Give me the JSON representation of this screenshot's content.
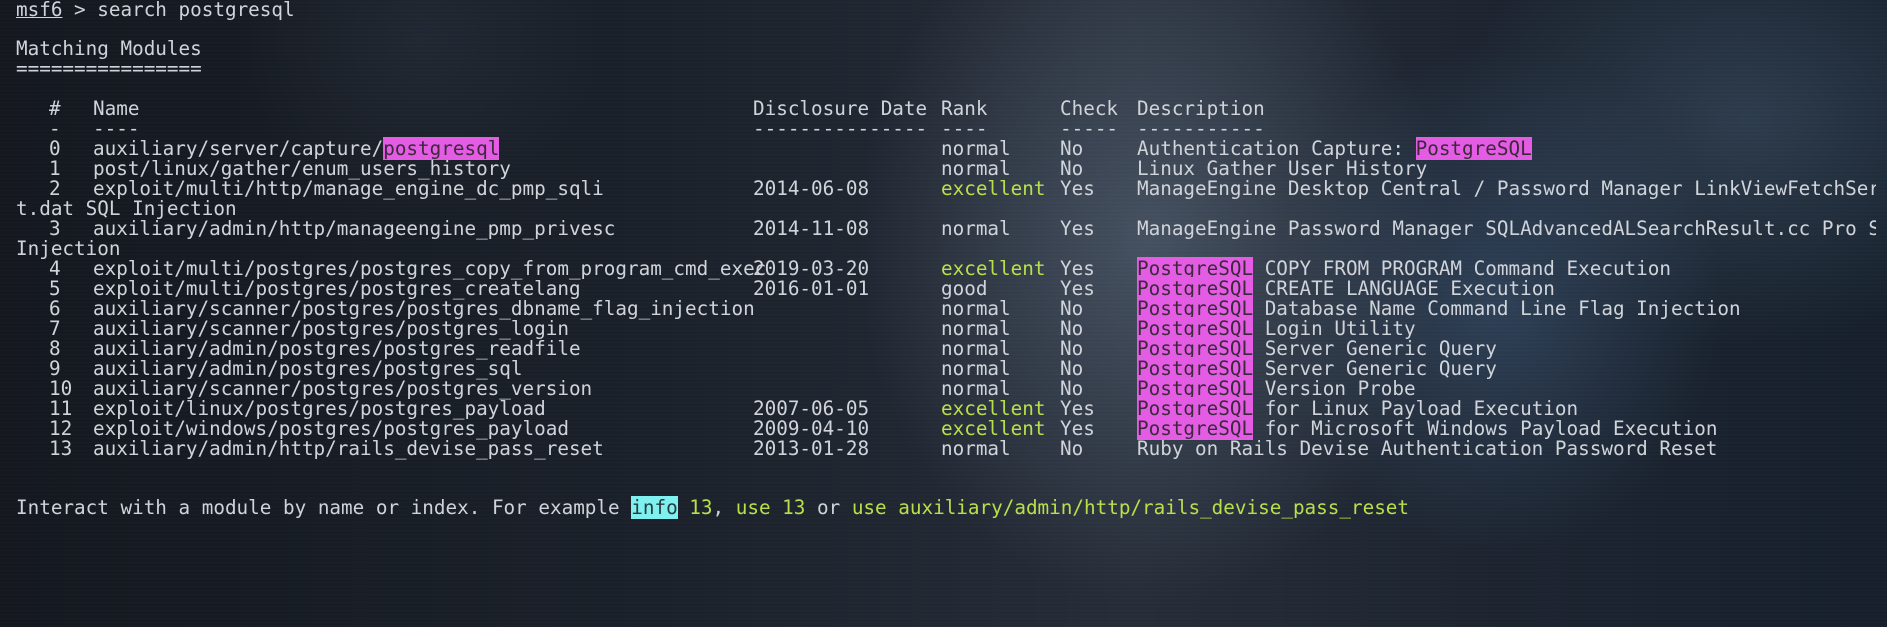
{
  "prompt": {
    "name": "msf6",
    "separator": " > ",
    "command": "search postgresql"
  },
  "section_title": "Matching Modules",
  "section_underline": "================",
  "columns": {
    "num": "#",
    "name": "Name",
    "date": "Disclosure Date",
    "rank": "Rank",
    "check": "Check",
    "desc": "Description"
  },
  "column_underlines": {
    "num": "-",
    "name": "----",
    "date": "---------------",
    "rank": "----",
    "check": "-----",
    "desc": "-----------"
  },
  "rows": [
    {
      "num": "0",
      "name_pre": "auxiliary/server/capture/",
      "name_hl": "postgresql",
      "date": "",
      "rank": "normal",
      "check": "No",
      "desc_pre": "Authentication Capture: ",
      "desc_hl": "PostgreSQL",
      "desc": ""
    },
    {
      "num": "1",
      "name_pre": "post/linux/gather/enum_users_history",
      "name_hl": "",
      "date": "",
      "rank": "normal",
      "check": "No",
      "desc_pre": "",
      "desc_hl": "",
      "desc": "Linux Gather User History"
    },
    {
      "num": "2",
      "name_pre": "exploit/multi/http/manage_engine_dc_pmp_sqli",
      "name_hl": "",
      "date": "2014-06-08",
      "rank": "excellent",
      "check": "Yes",
      "desc_pre": "",
      "desc_hl": "",
      "desc": "ManageEngine Desktop Central / Password Manager LinkViewFetchServle",
      "wrap": "t.dat SQL Injection"
    },
    {
      "num": "3",
      "name_pre": "auxiliary/admin/http/manageengine_pmp_privesc",
      "name_hl": "",
      "date": "2014-11-08",
      "rank": "normal",
      "check": "Yes",
      "desc_pre": "",
      "desc_hl": "",
      "desc": "ManageEngine Password Manager SQLAdvancedALSearchResult.cc Pro SQL",
      "wrap": "Injection"
    },
    {
      "num": "4",
      "name_pre": "exploit/multi/postgres/postgres_copy_from_program_cmd_exec",
      "name_hl": "",
      "date": "2019-03-20",
      "rank": "excellent",
      "check": "Yes",
      "desc_pre": "",
      "desc_hl": "PostgreSQL",
      "desc": " COPY FROM PROGRAM Command Execution"
    },
    {
      "num": "5",
      "name_pre": "exploit/multi/postgres/postgres_createlang",
      "name_hl": "",
      "date": "2016-01-01",
      "rank": "good",
      "check": "Yes",
      "desc_pre": "",
      "desc_hl": "PostgreSQL",
      "desc": " CREATE LANGUAGE Execution"
    },
    {
      "num": "6",
      "name_pre": "auxiliary/scanner/postgres/postgres_dbname_flag_injection",
      "name_hl": "",
      "date": "",
      "rank": "normal",
      "check": "No",
      "desc_pre": "",
      "desc_hl": "PostgreSQL",
      "desc": " Database Name Command Line Flag Injection"
    },
    {
      "num": "7",
      "name_pre": "auxiliary/scanner/postgres/postgres_login",
      "name_hl": "",
      "date": "",
      "rank": "normal",
      "check": "No",
      "desc_pre": "",
      "desc_hl": "PostgreSQL",
      "desc": " Login Utility"
    },
    {
      "num": "8",
      "name_pre": "auxiliary/admin/postgres/postgres_readfile",
      "name_hl": "",
      "date": "",
      "rank": "normal",
      "check": "No",
      "desc_pre": "",
      "desc_hl": "PostgreSQL",
      "desc": " Server Generic Query"
    },
    {
      "num": "9",
      "name_pre": "auxiliary/admin/postgres/postgres_sql",
      "name_hl": "",
      "date": "",
      "rank": "normal",
      "check": "No",
      "desc_pre": "",
      "desc_hl": "PostgreSQL",
      "desc": " Server Generic Query"
    },
    {
      "num": "10",
      "name_pre": "auxiliary/scanner/postgres/postgres_version",
      "name_hl": "",
      "date": "",
      "rank": "normal",
      "check": "No",
      "desc_pre": "",
      "desc_hl": "PostgreSQL",
      "desc": " Version Probe"
    },
    {
      "num": "11",
      "name_pre": "exploit/linux/postgres/postgres_payload",
      "name_hl": "",
      "date": "2007-06-05",
      "rank": "excellent",
      "check": "Yes",
      "desc_pre": "",
      "desc_hl": "PostgreSQL",
      "desc": " for Linux Payload Execution"
    },
    {
      "num": "12",
      "name_pre": "exploit/windows/postgres/postgres_payload",
      "name_hl": "",
      "date": "2009-04-10",
      "rank": "excellent",
      "check": "Yes",
      "desc_pre": "",
      "desc_hl": "PostgreSQL",
      "desc": " for Microsoft Windows Payload Execution"
    },
    {
      "num": "13",
      "name_pre": "auxiliary/admin/http/rails_devise_pass_reset",
      "name_hl": "",
      "date": "2013-01-28",
      "rank": "normal",
      "check": "No",
      "desc_pre": "",
      "desc_hl": "",
      "desc": "Ruby on Rails Devise Authentication Password Reset"
    }
  ],
  "footer": {
    "pre": "Interact with a module by name or index. For example ",
    "info": "info",
    "mid1": " 13",
    "sep1": ", ",
    "use1": "use 13",
    "sep2": " or ",
    "use2": "use auxiliary/admin/http/rails_devise_pass_reset"
  },
  "colors": {
    "highlight_pink": "#e45ce4",
    "highlight_cyan": "#7ef0f0",
    "rank_excellent": "#b8e04a",
    "text": "#d0d4da"
  }
}
